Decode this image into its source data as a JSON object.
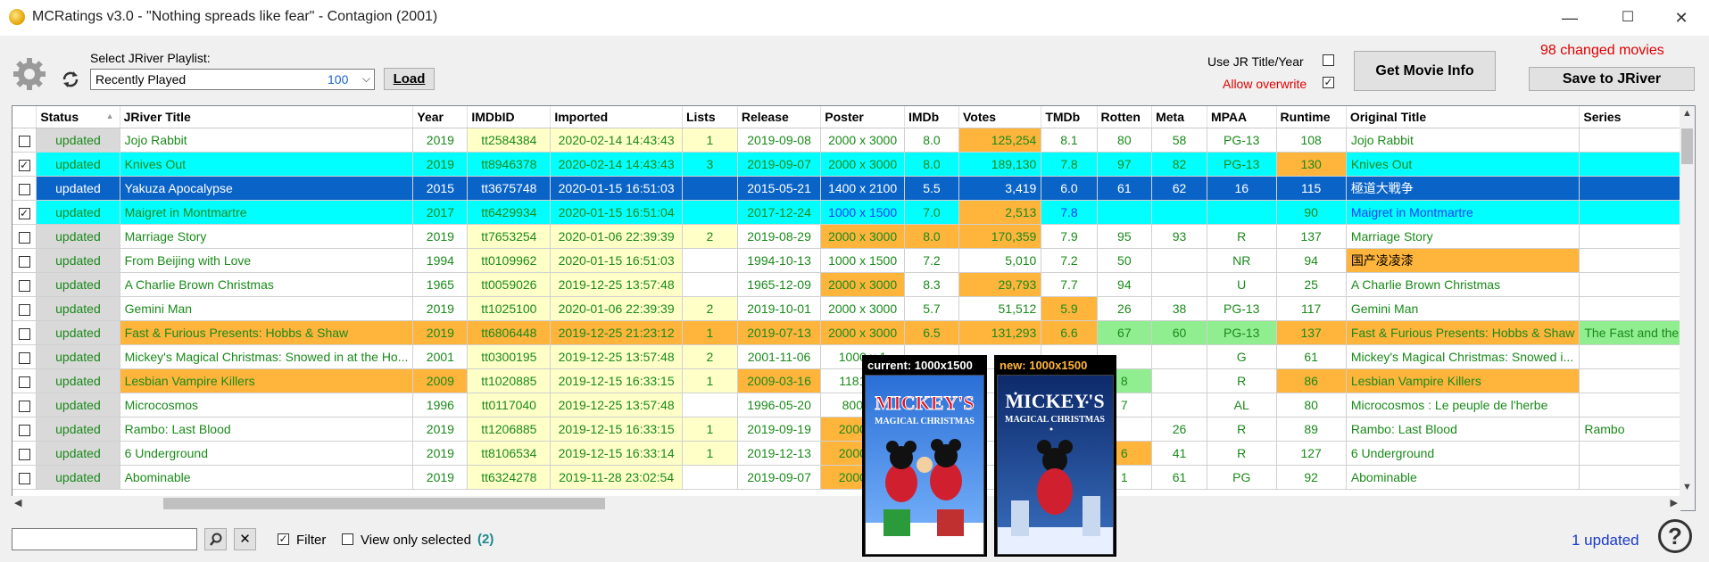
{
  "window": {
    "title": "MCRatings v3.0 - \"Nothing spreads like fear\" - Contagion (2001)",
    "minimize": "—",
    "maximize": "☐",
    "close": "✕"
  },
  "toolbar": {
    "playlist_label": "Select JRiver Playlist:",
    "playlist_value": "Recently Played",
    "playlist_count": "100",
    "load_label": "Load",
    "use_jr_title": "Use JR Title/Year",
    "allow_overwrite": "Allow overwrite",
    "get_info_label": "Get Movie Info",
    "changed_text": "98 changed movies",
    "save_label": "Save to JRiver"
  },
  "table": {
    "columns": [
      "",
      "Status",
      "JRiver Title",
      "Year",
      "IMDbID",
      "Imported",
      "Lists",
      "Release",
      "Poster",
      "IMDb",
      "Votes",
      "TMDb",
      "Rotten",
      "Meta",
      "MPAA",
      "Runtime",
      "Original Title",
      "Series"
    ],
    "rows": [
      {
        "checked": false,
        "status": "updated",
        "title": "Jojo Rabbit",
        "year": "2019",
        "imdbid": "tt2584384",
        "imported": "2020-02-14 14:43:43",
        "lists": "1",
        "release": "2019-09-08",
        "poster": "2000 x 3000",
        "imdb": "8.0",
        "votes": "125,254",
        "tmdb": "8.1",
        "rotten": "80",
        "meta": "58",
        "mpaa": "PG-13",
        "runtime": "108",
        "original": "Jojo Rabbit",
        "series": ""
      },
      {
        "checked": true,
        "status": "updated",
        "title": "Knives Out",
        "year": "2019",
        "imdbid": "tt8946378",
        "imported": "2020-02-14 14:43:43",
        "lists": "3",
        "release": "2019-09-07",
        "poster": "2000 x 3000",
        "imdb": "8.0",
        "votes": "189,130",
        "tmdb": "7.8",
        "rotten": "97",
        "meta": "82",
        "mpaa": "PG-13",
        "runtime": "130",
        "original": "Knives Out",
        "series": ""
      },
      {
        "checked": false,
        "status": "updated",
        "title": "Yakuza Apocalypse",
        "year": "2015",
        "imdbid": "tt3675748",
        "imported": "2020-01-15 16:51:03",
        "lists": "",
        "release": "2015-05-21",
        "poster": "1400 x 2100",
        "imdb": "5.5",
        "votes": "3,419",
        "tmdb": "6.0",
        "rotten": "61",
        "meta": "62",
        "mpaa": "16",
        "runtime": "115",
        "original": "極道大戦争",
        "series": ""
      },
      {
        "checked": true,
        "status": "updated",
        "title": "Maigret in Montmartre",
        "year": "2017",
        "imdbid": "tt6429934",
        "imported": "2020-01-15 16:51:04",
        "lists": "",
        "release": "2017-12-24",
        "poster": "1000 x 1500",
        "imdb": "7.0",
        "votes": "2,513",
        "tmdb": "7.8",
        "rotten": "",
        "meta": "",
        "mpaa": "",
        "runtime": "90",
        "original": "Maigret in Montmartre",
        "series": ""
      },
      {
        "checked": false,
        "status": "updated",
        "title": "Marriage Story",
        "year": "2019",
        "imdbid": "tt7653254",
        "imported": "2020-01-06 22:39:39",
        "lists": "2",
        "release": "2019-08-29",
        "poster": "2000 x 3000",
        "imdb": "8.0",
        "votes": "170,359",
        "tmdb": "7.9",
        "rotten": "95",
        "meta": "93",
        "mpaa": "R",
        "runtime": "137",
        "original": "Marriage Story",
        "series": ""
      },
      {
        "checked": false,
        "status": "updated",
        "title": "From Beijing with Love",
        "year": "1994",
        "imdbid": "tt0109962",
        "imported": "2020-01-15 16:51:03",
        "lists": "",
        "release": "1994-10-13",
        "poster": "1000 x 1500",
        "imdb": "7.2",
        "votes": "5,010",
        "tmdb": "7.2",
        "rotten": "50",
        "meta": "",
        "mpaa": "NR",
        "runtime": "94",
        "original": "国产凌凌漆",
        "series": ""
      },
      {
        "checked": false,
        "status": "updated",
        "title": "A Charlie Brown Christmas",
        "year": "1965",
        "imdbid": "tt0059026",
        "imported": "2019-12-25 13:57:48",
        "lists": "",
        "release": "1965-12-09",
        "poster": "2000 x 3000",
        "imdb": "8.3",
        "votes": "29,793",
        "tmdb": "7.7",
        "rotten": "94",
        "meta": "",
        "mpaa": "U",
        "runtime": "25",
        "original": "A Charlie Brown Christmas",
        "series": ""
      },
      {
        "checked": false,
        "status": "updated",
        "title": "Gemini Man",
        "year": "2019",
        "imdbid": "tt1025100",
        "imported": "2020-01-06 22:39:39",
        "lists": "2",
        "release": "2019-10-01",
        "poster": "2000 x 3000",
        "imdb": "5.7",
        "votes": "51,512",
        "tmdb": "5.9",
        "rotten": "26",
        "meta": "38",
        "mpaa": "PG-13",
        "runtime": "117",
        "original": "Gemini Man",
        "series": ""
      },
      {
        "checked": false,
        "status": "updated",
        "title": "Fast & Furious Presents: Hobbs & Shaw",
        "year": "2019",
        "imdbid": "tt6806448",
        "imported": "2019-12-25 21:23:12",
        "lists": "1",
        "release": "2019-07-13",
        "poster": "2000 x 3000",
        "imdb": "6.5",
        "votes": "131,293",
        "tmdb": "6.6",
        "rotten": "67",
        "meta": "60",
        "mpaa": "PG-13",
        "runtime": "137",
        "original": "Fast & Furious Presents: Hobbs & Shaw",
        "series": "The Fast and the..."
      },
      {
        "checked": false,
        "status": "updated",
        "title": "Mickey's Magical Christmas: Snowed in at the Ho...",
        "year": "2001",
        "imdbid": "tt0300195",
        "imported": "2019-12-25 13:57:48",
        "lists": "2",
        "release": "2001-11-06",
        "poster": "1000 x 1",
        "imdb": "",
        "votes": "",
        "tmdb": "",
        "rotten": "",
        "meta": "",
        "mpaa": "G",
        "runtime": "61",
        "original": "Mickey's Magical Christmas: Snowed i...",
        "series": ""
      },
      {
        "checked": false,
        "status": "updated",
        "title": "Lesbian Vampire Killers",
        "year": "2009",
        "imdbid": "tt1020885",
        "imported": "2019-12-15 16:33:15",
        "lists": "1",
        "release": "2009-03-16",
        "poster": "1181 x 1",
        "imdb": "",
        "votes": "",
        "tmdb": "",
        "rotten": "8",
        "meta": "",
        "mpaa": "R",
        "runtime": "86",
        "original": "Lesbian Vampire Killers",
        "series": ""
      },
      {
        "checked": false,
        "status": "updated",
        "title": "Microcosmos",
        "year": "1996",
        "imdbid": "tt0117040",
        "imported": "2019-12-25 13:57:48",
        "lists": "",
        "release": "1996-05-20",
        "poster": "800 x 1",
        "imdb": "",
        "votes": "",
        "tmdb": "",
        "rotten": "7",
        "meta": "",
        "mpaa": "AL",
        "runtime": "80",
        "original": "Microcosmos : Le peuple de l'herbe",
        "series": ""
      },
      {
        "checked": false,
        "status": "updated",
        "title": "Rambo: Last Blood",
        "year": "2019",
        "imdbid": "tt1206885",
        "imported": "2019-12-15 16:33:15",
        "lists": "1",
        "release": "2019-09-19",
        "poster": "2000 x 3",
        "imdb": "",
        "votes": "",
        "tmdb": "",
        "rotten": "",
        "meta": "26",
        "mpaa": "R",
        "runtime": "89",
        "original": "Rambo: Last Blood",
        "series": "Rambo"
      },
      {
        "checked": false,
        "status": "updated",
        "title": "6 Underground",
        "year": "2019",
        "imdbid": "tt8106534",
        "imported": "2019-12-15 16:33:14",
        "lists": "1",
        "release": "2019-12-13",
        "poster": "2000 x 3",
        "imdb": "",
        "votes": "",
        "tmdb": "",
        "rotten": "6",
        "meta": "41",
        "mpaa": "R",
        "runtime": "127",
        "original": "6 Underground",
        "series": ""
      },
      {
        "checked": false,
        "status": "updated",
        "title": "Abominable",
        "year": "2019",
        "imdbid": "tt6324278",
        "imported": "2019-11-28 23:02:54",
        "lists": "",
        "release": "2019-09-07",
        "poster": "2000 x 3",
        "imdb": "",
        "votes": "",
        "tmdb": "",
        "rotten": "1",
        "meta": "61",
        "mpaa": "PG",
        "runtime": "92",
        "original": "Abominable",
        "series": ""
      }
    ]
  },
  "popup_current": {
    "caption": "current: 1000x1500",
    "poster_title": "MICKEY'S",
    "poster_sub": "MAGICAL CHRISTMAS"
  },
  "popup_new": {
    "caption": "new: 1000x1500",
    "poster_title": "MICKEY'S",
    "poster_sub": "MAGICAL CHRISTMAS"
  },
  "footer": {
    "search_value": "",
    "filter_label": "Filter",
    "view_selected_label": "View only selected",
    "selected_count": "(2)",
    "updated_text": "1 updated",
    "help": "?"
  },
  "colors": {
    "accent_red": "#e00000",
    "selected_blue": "#0a64c8",
    "cyan": "#00ffff",
    "orange": "#ffb43c",
    "yellow": "#ffffc8",
    "green_text": "#1a8a1a"
  }
}
